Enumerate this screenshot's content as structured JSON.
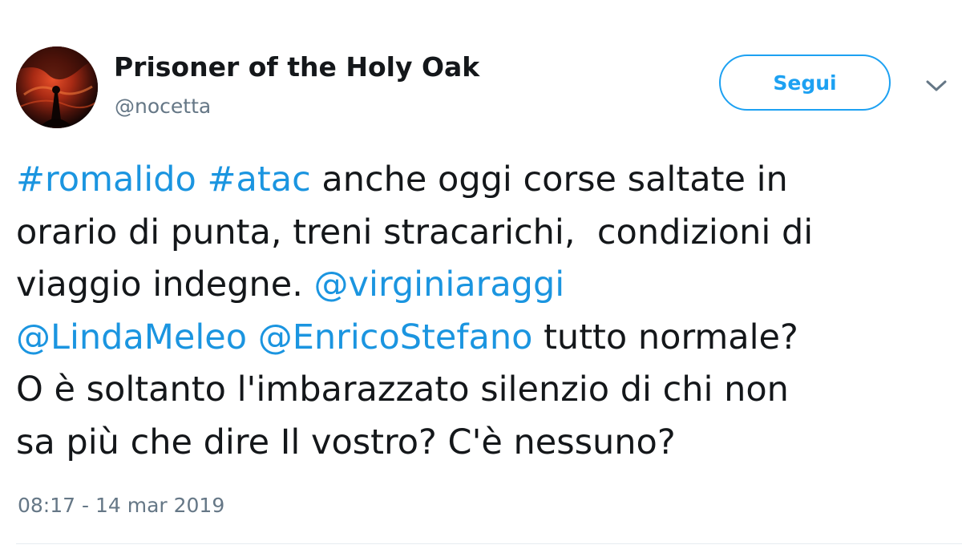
{
  "user": {
    "display_name": "Prisoner of the Holy Oak",
    "handle": "@nocetta"
  },
  "follow_button": {
    "label": "Segui"
  },
  "icons": {
    "caret": "chevron-down-icon",
    "avatar": "profile-photo"
  },
  "tweet": {
    "line1": {
      "hashtag1": "#romalido",
      "hashtag2": "#atac",
      "text": " anche oggi corse saltate in"
    },
    "line2": {
      "text": "orario di punta, treni stracarichi,  condizioni di"
    },
    "line3": {
      "text": "viaggio indegne. ",
      "mention1": "@virginiaraggi"
    },
    "line4": {
      "mention2": "@LindaMeleo",
      "mention3": "@EnricoStefano",
      "text": " tutto normale?"
    },
    "line5": {
      "text": "O è soltanto l'imbarazzato silenzio di chi non"
    },
    "line6": {
      "text": "sa più che dire Il vostro? C'è nessuno?"
    }
  },
  "timestamp": "08:17 - 14 mar 2019",
  "colors": {
    "link": "#1b95e0",
    "follow_border": "#1da1f2",
    "secondary_text": "#657786",
    "primary_text": "#14171a"
  }
}
